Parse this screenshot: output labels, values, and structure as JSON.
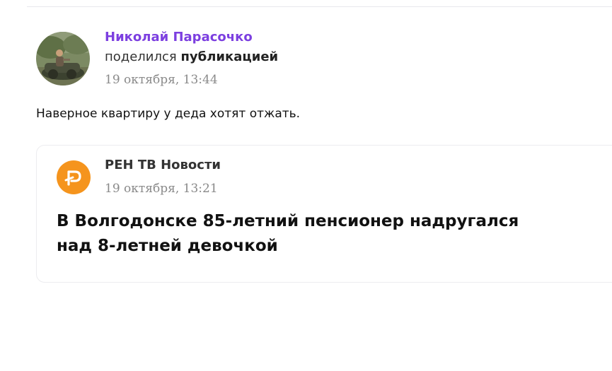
{
  "post": {
    "author_name": "Николай Парасочко",
    "share_prefix": "поделился",
    "share_link": "публикацией",
    "date": "19 октября, 13:44",
    "text": "Наверное квартиру у деда хотят отжать."
  },
  "embed": {
    "source_name": "РЕН ТВ Новости",
    "date": "19 октября, 13:21",
    "title": "В Волгодонске 85-летний пенсионер надругался над 8-летней девочкой",
    "logo_color": "#f5941d"
  },
  "colors": {
    "author_name": "#7c3fe0",
    "date": "#8a8a8a"
  }
}
